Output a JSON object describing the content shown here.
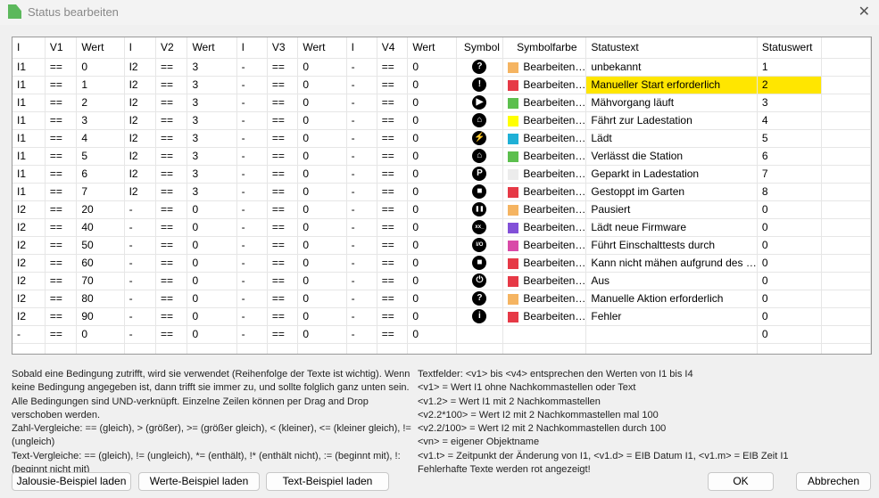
{
  "window": {
    "title": "Status bearbeiten",
    "close": "✕"
  },
  "columns": [
    "I",
    "V1",
    "Wert",
    "I",
    "V2",
    "Wert",
    "I",
    "V3",
    "Wert",
    "I",
    "V4",
    "Wert",
    "Symbol",
    "Symbolfarbe",
    "Statustext",
    "Statuswert",
    ""
  ],
  "rows": [
    {
      "c": [
        "I1",
        "==",
        "0",
        "I2",
        "==",
        "3",
        "-",
        "==",
        "0",
        "-",
        "==",
        "0"
      ],
      "icon": "question-pin-icon",
      "glyph": "?",
      "color": "#f5b461",
      "color_label": "Bearbeiten…",
      "text": "unbekannt",
      "value": "1"
    },
    {
      "c": [
        "I1",
        "==",
        "1",
        "I2",
        "==",
        "3",
        "-",
        "==",
        "0",
        "-",
        "==",
        "0"
      ],
      "icon": "exclamation-diamond-icon",
      "glyph": "!",
      "color": "#e63946",
      "color_label": "Bearbeiten…",
      "text": "Manueller Start erforderlich",
      "value": "2",
      "highlight": true
    },
    {
      "c": [
        "I1",
        "==",
        "2",
        "I2",
        "==",
        "3",
        "-",
        "==",
        "0",
        "-",
        "==",
        "0"
      ],
      "icon": "play-circle-icon",
      "glyph": "▶",
      "color": "#5cbf4e",
      "color_label": "Bearbeiten…",
      "text": "Mähvorgang läuft",
      "value": "3"
    },
    {
      "c": [
        "I1",
        "==",
        "3",
        "I2",
        "==",
        "3",
        "-",
        "==",
        "0",
        "-",
        "==",
        "0"
      ],
      "icon": "home-arrow-icon",
      "glyph": "⌂",
      "color": "#ffff00",
      "color_label": "Bearbeiten…",
      "text": "Fährt zur Ladestation",
      "value": "4"
    },
    {
      "c": [
        "I1",
        "==",
        "4",
        "I2",
        "==",
        "3",
        "-",
        "==",
        "0",
        "-",
        "==",
        "0"
      ],
      "icon": "charging-plug-icon",
      "glyph": "⚡",
      "color": "#1fb0d6",
      "color_label": "Bearbeiten…",
      "text": "Lädt",
      "value": "5"
    },
    {
      "c": [
        "I1",
        "==",
        "5",
        "I2",
        "==",
        "3",
        "-",
        "==",
        "0",
        "-",
        "==",
        "0"
      ],
      "icon": "home-leave-icon",
      "glyph": "⌂",
      "color": "#5cbf4e",
      "color_label": "Bearbeiten…",
      "text": "Verlässt die Station",
      "value": "6"
    },
    {
      "c": [
        "I1",
        "==",
        "6",
        "I2",
        "==",
        "3",
        "-",
        "==",
        "0",
        "-",
        "==",
        "0"
      ],
      "icon": "car-parking-icon",
      "glyph": "P",
      "color": "#ececec",
      "color_label": "Bearbeiten…",
      "text": "Geparkt in Ladestation",
      "value": "7"
    },
    {
      "c": [
        "I1",
        "==",
        "7",
        "I2",
        "==",
        "3",
        "-",
        "==",
        "0",
        "-",
        "==",
        "0"
      ],
      "icon": "stop-circle-icon",
      "glyph": "■",
      "color": "#e63946",
      "color_label": "Bearbeiten…",
      "text": "Gestoppt im Garten",
      "value": "8"
    },
    {
      "c": [
        "I2",
        "==",
        "20",
        "-",
        "==",
        "0",
        "-",
        "==",
        "0",
        "-",
        "==",
        "0"
      ],
      "icon": "pause-icon",
      "glyph": "❚❚",
      "color": "#f5b461",
      "color_label": "Bearbeiten…",
      "text": "Pausiert",
      "value": "0"
    },
    {
      "c": [
        "I2",
        "==",
        "40",
        "-",
        "==",
        "0",
        "-",
        "==",
        "0",
        "-",
        "==",
        "0"
      ],
      "icon": "firmware-icon",
      "glyph": "xx_",
      "color": "#8250d8",
      "color_label": "Bearbeiten…",
      "text": "Lädt neue Firmware",
      "value": "0"
    },
    {
      "c": [
        "I2",
        "==",
        "50",
        "-",
        "==",
        "0",
        "-",
        "==",
        "0",
        "-",
        "==",
        "0"
      ],
      "icon": "power-test-icon",
      "glyph": "I/O",
      "color": "#d94aa8",
      "color_label": "Bearbeiten…",
      "text": "Führt Einschalttests durch",
      "value": "0"
    },
    {
      "c": [
        "I2",
        "==",
        "60",
        "-",
        "==",
        "0",
        "-",
        "==",
        "0",
        "-",
        "==",
        "0"
      ],
      "icon": "square-icon",
      "glyph": "■",
      "color": "#e63946",
      "color_label": "Bearbeiten…",
      "text": "Kann nicht mähen aufgrund des …",
      "value": "0"
    },
    {
      "c": [
        "I2",
        "==",
        "70",
        "-",
        "==",
        "0",
        "-",
        "==",
        "0",
        "-",
        "==",
        "0"
      ],
      "icon": "power-icon",
      "glyph": "⏻",
      "color": "#e63946",
      "color_label": "Bearbeiten…",
      "text": "Aus",
      "value": "0"
    },
    {
      "c": [
        "I2",
        "==",
        "80",
        "-",
        "==",
        "0",
        "-",
        "==",
        "0",
        "-",
        "==",
        "0"
      ],
      "icon": "question-pin-icon",
      "glyph": "?",
      "color": "#f5b461",
      "color_label": "Bearbeiten…",
      "text": "Manuelle Aktion erforderlich",
      "value": "0"
    },
    {
      "c": [
        "I2",
        "==",
        "90",
        "-",
        "==",
        "0",
        "-",
        "==",
        "0",
        "-",
        "==",
        "0"
      ],
      "icon": "info-circle-icon",
      "glyph": "i",
      "color": "#e63946",
      "color_label": "Bearbeiten…",
      "text": "Fehler",
      "value": "0"
    },
    {
      "c": [
        "-",
        "==",
        "0",
        "-",
        "==",
        "0",
        "-",
        "==",
        "0",
        "-",
        "==",
        "0"
      ],
      "icon": "",
      "glyph": "",
      "color": "",
      "color_label": "",
      "text": "",
      "value": "0"
    }
  ],
  "help_left": [
    "Sobald eine Bedingung zutrifft, wird sie verwendet (Reihenfolge der Texte ist wichtig). Wenn keine Bedingung angegeben ist, dann trifft sie immer zu, und sollte folglich ganz unten sein. Alle Bedingungen sind UND-verknüpft. Einzelne Zeilen können per Drag and Drop verschoben werden.",
    "Zahl-Vergleiche: == (gleich), > (größer), >= (größer gleich), < (kleiner), <= (kleiner gleich), != (ungleich)",
    "Text-Vergleiche: == (gleich), != (ungleich), *= (enthält), !* (enthält nicht), := (beginnt mit), !: (beginnt nicht mit)"
  ],
  "help_right": [
    "Textfelder: <v1> bis <v4> entsprechen den Werten von I1 bis I4",
    "<v1> = Wert I1 ohne Nachkommastellen oder Text",
    "<v1.2> = Wert I1 mit 2 Nachkommastellen",
    "<v2.2*100> = Wert I2 mit 2 Nachkommastellen mal 100",
    "<v2.2/100> = Wert I2 mit 2 Nachkommastellen durch 100",
    "<vn> = eigener Objektname",
    "<v1.t> = Zeitpunkt der Änderung von I1, <v1.d> = EIB Datum I1, <v1.m> = EIB Zeit I1",
    "Fehlerhafte Texte werden rot angezeigt!"
  ],
  "buttons": {
    "jalousie": "Jalousie-Beispiel laden",
    "werte": "Werte-Beispiel laden",
    "text": "Text-Beispiel laden",
    "ok": "OK",
    "cancel": "Abbrechen"
  }
}
